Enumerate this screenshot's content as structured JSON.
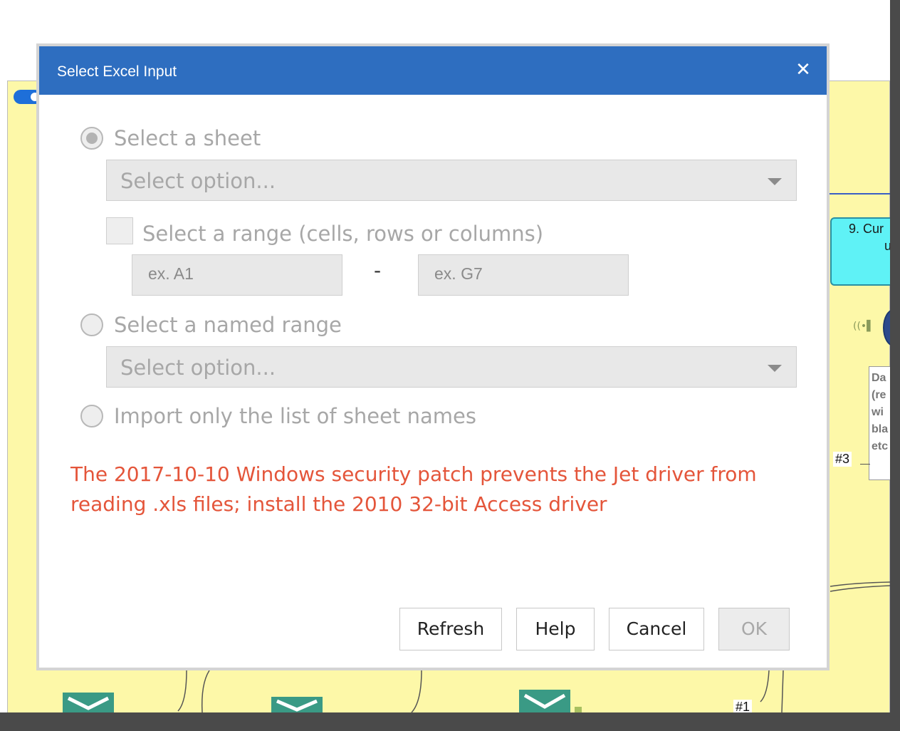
{
  "dialog": {
    "title": "Select Excel Input",
    "close_glyph": "✕",
    "sheet_option": {
      "label": "Select a sheet",
      "selected": true,
      "dropdown_placeholder": "Select option..."
    },
    "range_option": {
      "label": "Select a range (cells, rows or columns)",
      "from_placeholder": "ex. A1",
      "separator": "-",
      "to_placeholder": "ex. G7"
    },
    "named_range_option": {
      "label": "Select a named range",
      "selected": false,
      "dropdown_placeholder": "Select option..."
    },
    "sheet_names_option": {
      "label": "Import only the list of sheet names",
      "selected": false
    },
    "error_message": "The 2017-10-10 Windows security patch prevents the Jet driver from reading .xls files; install the 2010 32-bit Access driver",
    "buttons": {
      "refresh": "Refresh",
      "help": "Help",
      "cancel": "Cancel",
      "ok": "OK"
    }
  },
  "canvas": {
    "cyan_node_line1": "9. Cur",
    "cyan_node_line2": "u",
    "comment_lines": [
      "Da",
      "(re",
      "wi",
      "bla",
      "etc"
    ],
    "connection_label_3": "#3",
    "connection_label_1": "#1",
    "tool_icon_glyph": "((•▌"
  },
  "colors": {
    "title_bar": "#2e6ec0",
    "canvas_background": "#fdf8a8",
    "error_text": "#e4553a",
    "node_cyan": "#5ff2f6",
    "tool_teal": "#3a9a85"
  }
}
